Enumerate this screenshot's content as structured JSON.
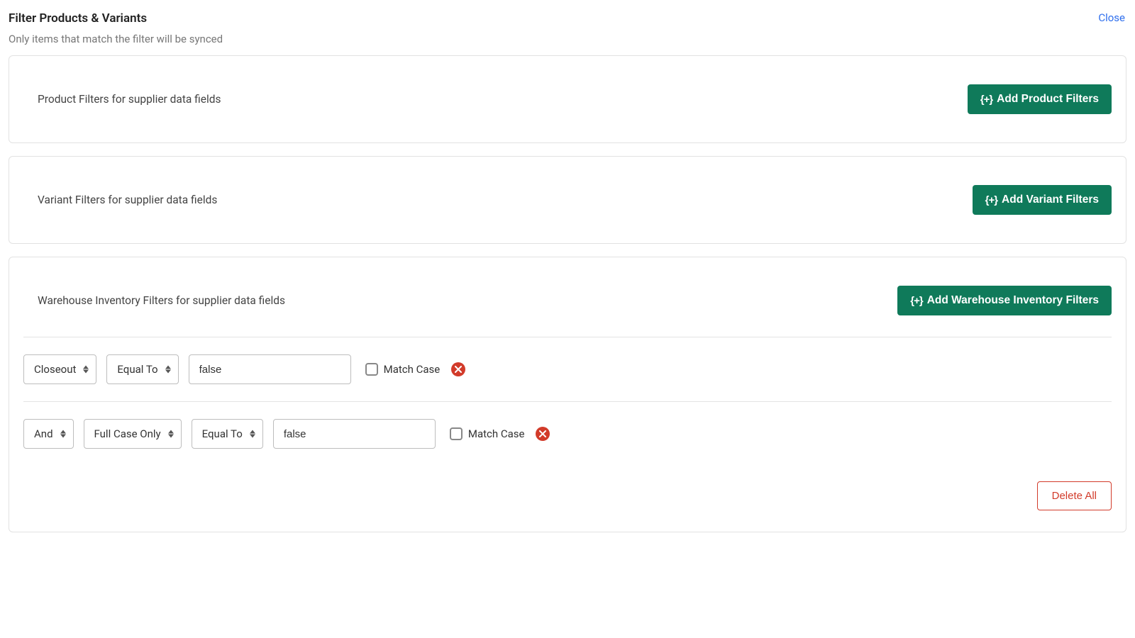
{
  "header": {
    "title": "Filter Products & Variants",
    "close": "Close",
    "subtitle": "Only items that match the filter will be synced"
  },
  "sections": {
    "product": {
      "label": "Product Filters for supplier data fields",
      "add_label": "Add Product Filters"
    },
    "variant": {
      "label": "Variant Filters for supplier data fields",
      "add_label": "Add Variant Filters"
    },
    "warehouse": {
      "label": "Warehouse Inventory Filters for supplier data fields",
      "add_label": "Add Warehouse Inventory Filters",
      "rows": [
        {
          "logic": null,
          "field": "Closeout",
          "operator": "Equal To",
          "value": "false",
          "match_case_label": "Match Case",
          "match_case_checked": false
        },
        {
          "logic": "And",
          "field": "Full Case Only",
          "operator": "Equal To",
          "value": "false",
          "match_case_label": "Match Case",
          "match_case_checked": false
        }
      ],
      "delete_all": "Delete All"
    }
  },
  "icons": {
    "add_prefix": "{+}"
  }
}
